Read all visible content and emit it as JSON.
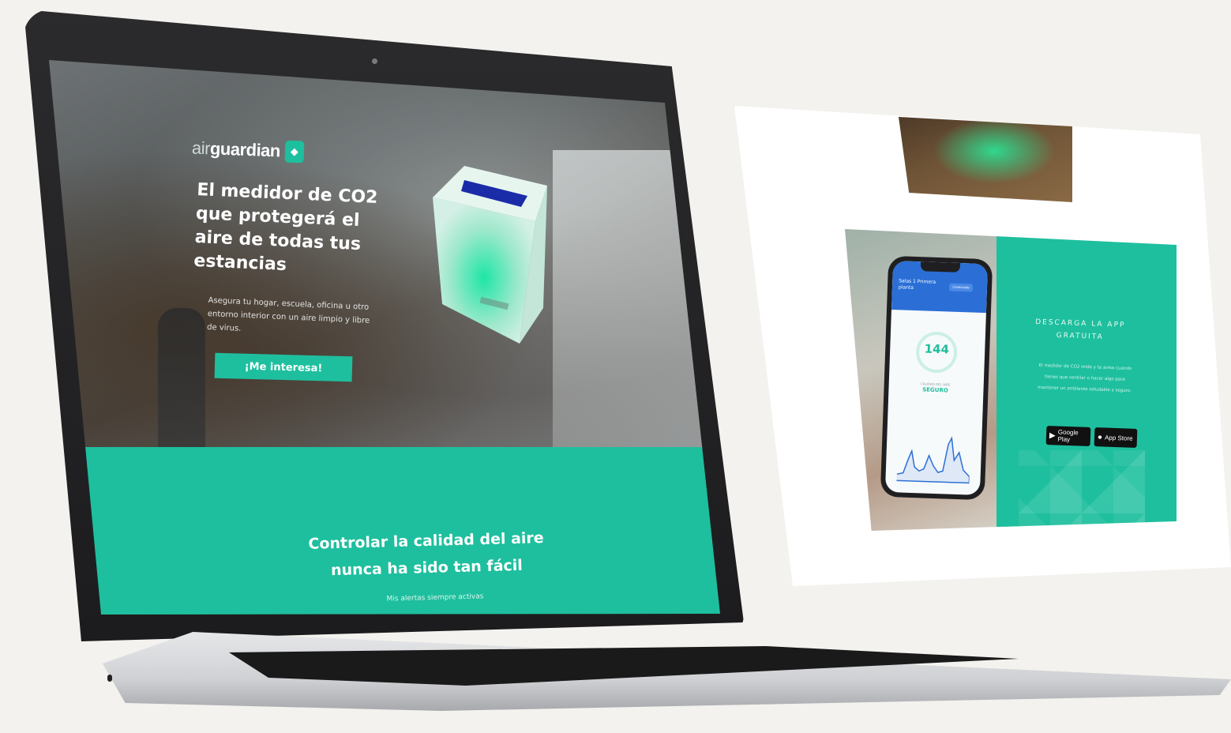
{
  "landing": {
    "logo_prefix": "air",
    "logo_name": "guardian",
    "logo_badge": "◆",
    "headline": "El medidor de CO2 que protegerá el aire de todas tus estancias",
    "description": "Asegura tu hogar, escuela, oficina u otro entorno interior con un aire limpio y libre de virus.",
    "cta": "¡Me interesa!",
    "band_title": "Controlar la calidad del aire nunca ha sido tan fácil",
    "band_subtitle": "Mis alertas siempre activas"
  },
  "app_promo": {
    "title": "DESCARGA LA APP GRATUITA",
    "description": "El medidor de CO2 mide y te avisa cuando tienes que ventilar o hacer algo para mantener un ambiente saludable y seguro.",
    "google_play": "Google Play",
    "app_store": "App Store"
  },
  "phone": {
    "room": "Salas 1 Primera planta",
    "pill": "Conectado",
    "value": "144",
    "status_label": "CALIDAD DEL AIRE",
    "status": "SEGURO"
  },
  "colors": {
    "accent": "#1ebf9e",
    "phone_header": "#2b6fd6"
  }
}
